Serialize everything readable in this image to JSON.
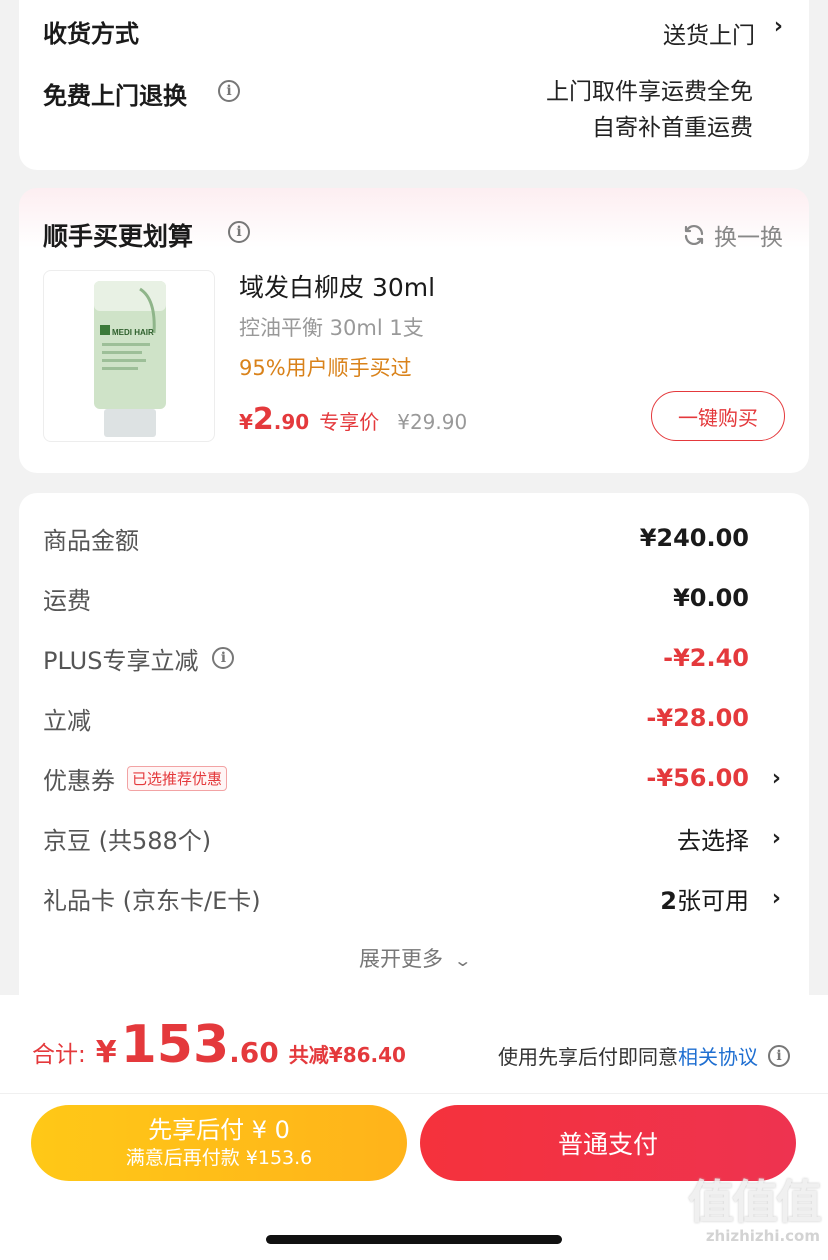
{
  "delivery": {
    "method_label": "收货方式",
    "method_value": "送货上门",
    "return_label": "免费上门退换",
    "return_line1": "上门取件享运费全免",
    "return_line2": "自寄补首重运费"
  },
  "addon": {
    "title": "顺手买更划算",
    "refresh_label": "换一换",
    "product": {
      "image_brand": "MEDI HAIR",
      "name": "域发白柳皮 30ml",
      "spec": "控油平衡 30ml 1支",
      "social_proof": "95%用户顺手买过",
      "currency": "¥",
      "price_int": "2",
      "price_dec": ".90",
      "price_tag": "专享价",
      "original_price": "¥29.90",
      "buy_label": "一键购买"
    }
  },
  "price_details": {
    "rows": [
      {
        "label": "商品金额",
        "value": "¥240.00"
      },
      {
        "label": "运费",
        "value": "¥0.00"
      },
      {
        "label": "PLUS专享立减",
        "value": "-¥2.40"
      },
      {
        "label": "立减",
        "value": "-¥28.00"
      },
      {
        "label": "优惠券",
        "badge": "已选推荐优惠",
        "value": "-¥56.00"
      },
      {
        "label": "京豆 (共588个)",
        "value": "去选择"
      },
      {
        "label": "礼品卡 (京东卡/E卡)",
        "value_num": "2",
        "value": "张可用"
      }
    ],
    "expand_label": "展开更多"
  },
  "footer": {
    "total_label": "合计:",
    "currency": "¥",
    "total_int": "153",
    "total_dec": ".60",
    "saved_label": "共减¥86.40",
    "agreement_prefix": "使用先享后付即同意",
    "agreement_link": "相关协议",
    "paylater_line1": "先享后付 ¥ 0",
    "paylater_line2": "满意后再付款 ¥153.6",
    "pay_label": "普通支付"
  },
  "watermark": {
    "logo_text": "值值值",
    "url": "zhizhizhi.com"
  },
  "colors": {
    "accent_red": "#e4393c",
    "orange_text": "#d9821a",
    "link_blue": "#1f6fd1",
    "paylater_yellow": "#ffc21a",
    "pay_red": "#f0323c"
  }
}
